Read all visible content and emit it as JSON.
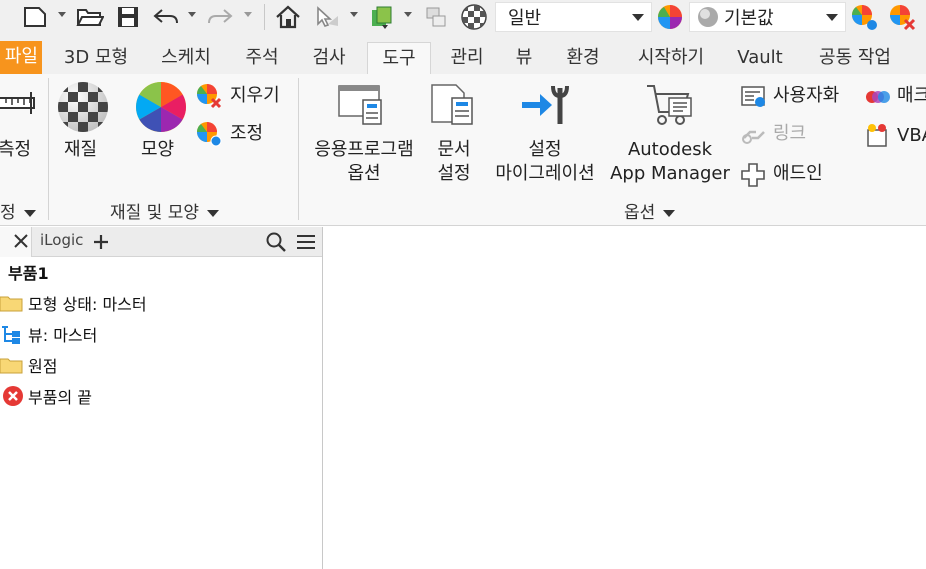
{
  "quick_access": {
    "style_combo": "일반",
    "appearance_combo": "기본값"
  },
  "tabs": [
    {
      "label": "파일",
      "shown": "파일"
    },
    {
      "label": "3D 모형"
    },
    {
      "label": "스케치"
    },
    {
      "label": "주석"
    },
    {
      "label": "검사"
    },
    {
      "label": "도구"
    },
    {
      "label": "관리"
    },
    {
      "label": "뷰"
    },
    {
      "label": "환경"
    },
    {
      "label": "시작하기"
    },
    {
      "label": "Vault"
    },
    {
      "label": "공동 작업"
    }
  ],
  "ribbon": {
    "measure_label": "측정",
    "measure_panel": "정",
    "material_label": "재질",
    "appearance_label": "모양",
    "clear_label": "지우기",
    "adjust_label": "조정",
    "material_panel": "재질 및 모양",
    "app_options_line1": "응용프로그램",
    "app_options_line2": "옵션",
    "doc_settings_line1": "문서",
    "doc_settings_line2": "설정",
    "migrate_line1": "설정",
    "migrate_line2": "마이그레이션",
    "app_manager_line1": "Autodesk",
    "app_manager_line2": "App Manager",
    "customize_label": "사용자화",
    "link_label": "링크",
    "addins_label": "애드인",
    "macros_label": "매크",
    "vba_label": "VBA",
    "options_panel": "옵션"
  },
  "browser": {
    "tab_ilogic": "iLogic",
    "tree": [
      {
        "label": "부품1",
        "icon": "part-icon"
      },
      {
        "label": "모형 상태: 마스터",
        "icon": "folder-icon"
      },
      {
        "label": "뷰: 마스터",
        "icon": "view-tree-icon"
      },
      {
        "label": "원점",
        "icon": "folder-icon"
      },
      {
        "label": "부품의 끝",
        "icon": "end-of-part-icon"
      }
    ]
  },
  "colors": {
    "file_tab": "#f7941d",
    "ribbon_bg": "#f8f8f8",
    "toolbar_bg": "#f0f0f0",
    "accent_blue": "#1e88e5"
  }
}
